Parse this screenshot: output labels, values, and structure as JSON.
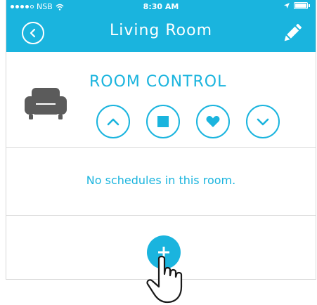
{
  "status_bar": {
    "carrier": "NSB",
    "time": "8:30 AM"
  },
  "header": {
    "title": "Living Room",
    "back_icon": "chevron-left-circle-icon",
    "edit_icon": "pencil-icon"
  },
  "room_control": {
    "title": "ROOM CONTROL",
    "room_icon": "sofa-icon",
    "buttons": [
      {
        "name": "up",
        "icon": "chevron-up-icon"
      },
      {
        "name": "stop",
        "icon": "stop-square-icon"
      },
      {
        "name": "favorite",
        "icon": "heart-icon"
      },
      {
        "name": "down",
        "icon": "chevron-down-icon"
      }
    ]
  },
  "schedules": {
    "empty_message": "No schedules in this room."
  },
  "add_button": {
    "icon": "plus-icon"
  },
  "colors": {
    "accent": "#1ab4de",
    "icon_gray": "#5b5b5b"
  }
}
